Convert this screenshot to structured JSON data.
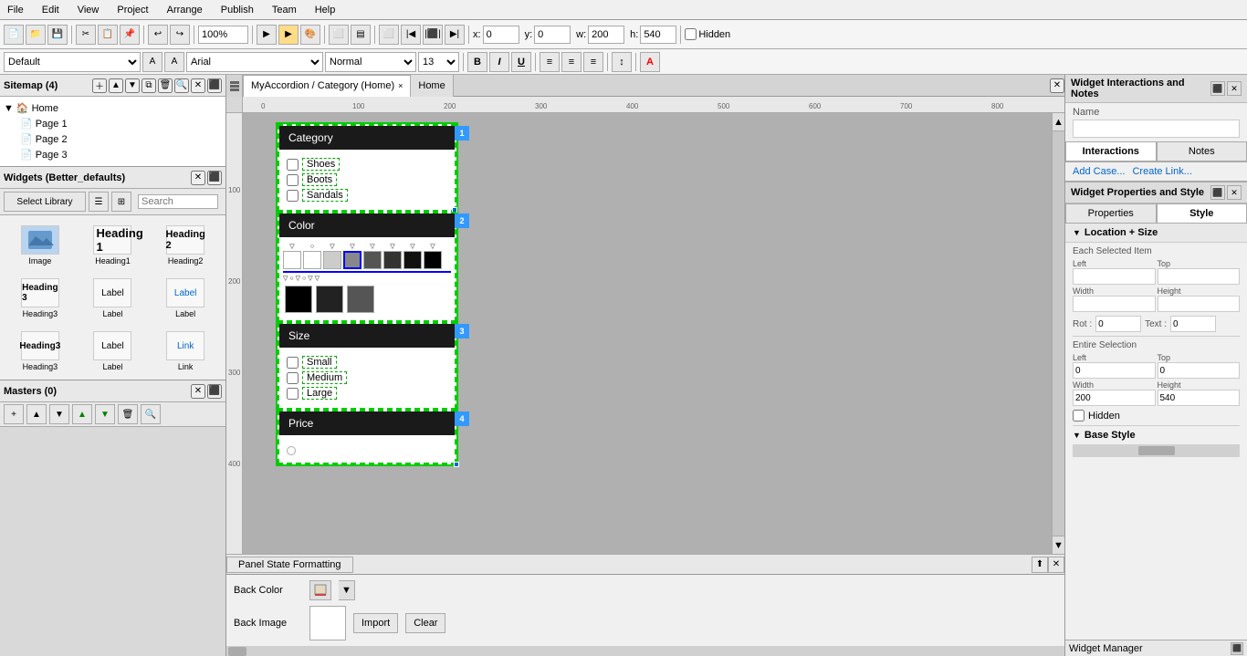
{
  "menubar": {
    "items": [
      "File",
      "Edit",
      "View",
      "Project",
      "Arrange",
      "Publish",
      "Team",
      "Help"
    ]
  },
  "toolbar1": {
    "zoom": "100%",
    "x_label": "x:",
    "x_value": "0",
    "y_label": "y:",
    "y_value": "0",
    "w_label": "w:",
    "w_value": "200",
    "h_label": "h:",
    "h_value": "540",
    "hidden_label": "Hidden"
  },
  "toolbar2": {
    "font": "Arial",
    "style": "Normal",
    "size": "13"
  },
  "sitemap": {
    "title": "Sitemap (4)",
    "home": "Home",
    "pages": [
      "Page 1",
      "Page 2",
      "Page 3"
    ]
  },
  "widgets": {
    "title": "Widgets (Better_defaults)",
    "library_label": "Select Library",
    "search_placeholder": "Search",
    "items": [
      {
        "label": "Image",
        "type": "image"
      },
      {
        "label": "Heading1",
        "type": "h1"
      },
      {
        "label": "Heading2",
        "type": "h2"
      },
      {
        "label": "Heading3",
        "type": "h3"
      },
      {
        "label": "Label",
        "type": "label"
      },
      {
        "label": "Label",
        "type": "label-blue"
      },
      {
        "label": "Heading3",
        "type": "h3-2"
      },
      {
        "label": "Label",
        "type": "label2"
      },
      {
        "label": "Link",
        "type": "link"
      }
    ]
  },
  "masters": {
    "title": "Masters (0)"
  },
  "canvas": {
    "tab_label": "MyAccordion / Category (Home)",
    "tab_close": "×",
    "page_tab": "Home",
    "ruler_marks": [
      "0",
      "100",
      "200",
      "300",
      "400",
      "500",
      "600",
      "700",
      "800"
    ],
    "ruler_v_marks": [
      "100",
      "200",
      "300",
      "400"
    ]
  },
  "accordion": {
    "sections": [
      {
        "id": 1,
        "title": "Category",
        "items": [
          "Shoes",
          "Boots",
          "Sandals"
        ]
      },
      {
        "id": 2,
        "title": "Color",
        "swatches": true
      },
      {
        "id": 3,
        "title": "Size",
        "items": [
          "Small",
          "Medium",
          "Large"
        ]
      },
      {
        "id": 4,
        "title": "Price",
        "items": []
      }
    ]
  },
  "panel_state": {
    "label": "Panel State Formatting"
  },
  "bottom_panel": {
    "back_color_label": "Back Color",
    "back_image_label": "Back Image",
    "import_btn": "Import",
    "clear_btn": "Clear"
  },
  "interactions_panel": {
    "title": "Widget Interactions and Notes",
    "name_label": "Name",
    "interactions_tab": "Interactions",
    "notes_tab": "Notes",
    "add_case": "Add Case...",
    "create_link": "Create Link..."
  },
  "properties_panel": {
    "title": "Widget Properties and Style",
    "properties_tab": "Properties",
    "style_tab": "Style",
    "location_size_title": "Location + Size",
    "each_selected_label": "Each Selected Item",
    "left_label": "Left",
    "top_label": "Top",
    "width_label": "Width",
    "height_label": "Height",
    "rot_label": "Rot :",
    "text_label": "Text :",
    "rot_value": "0",
    "text_value": "0",
    "entire_selection_label": "Entire Selection",
    "e_left_value": "0",
    "e_top_value": "0",
    "e_width_value": "200",
    "e_height_value": "540",
    "hidden_label": "Hidden",
    "base_style_title": "Base Style"
  }
}
